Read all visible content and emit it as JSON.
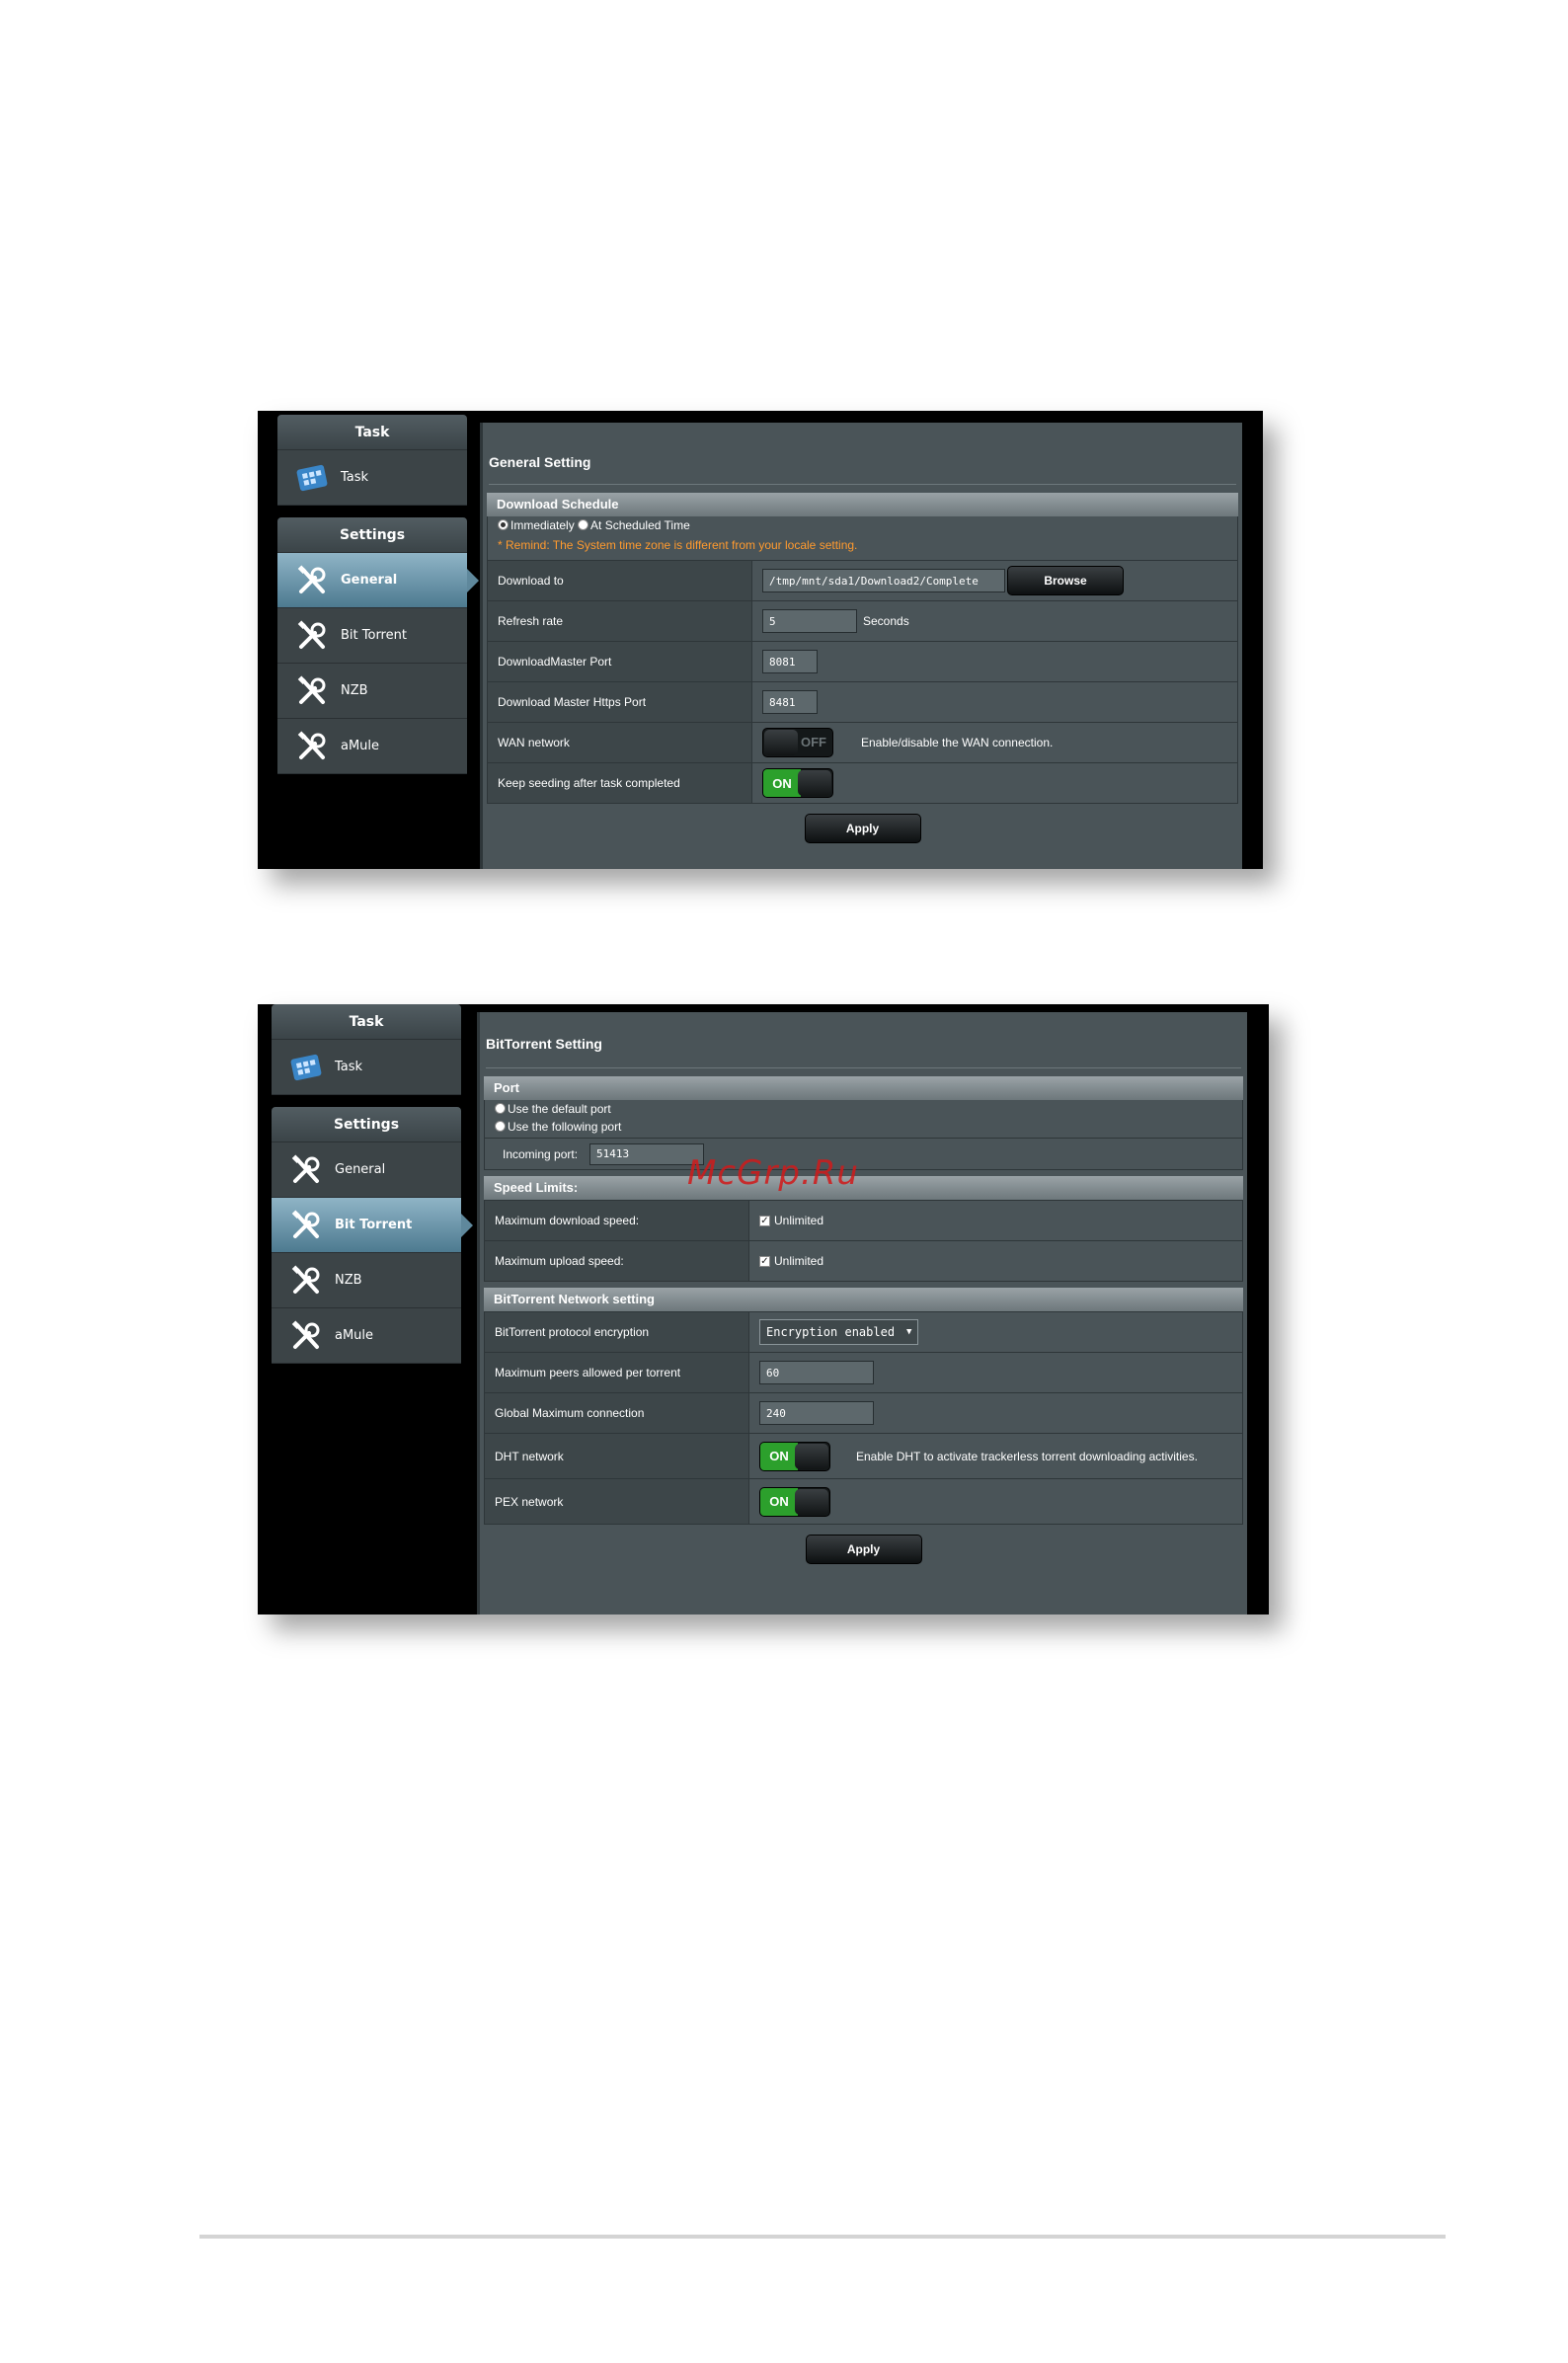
{
  "screenshot1": {
    "nav": {
      "task_header": "Task",
      "task_item": "Task",
      "settings_header": "Settings",
      "items": [
        "General",
        "Bit Torrent",
        "NZB",
        "aMule"
      ],
      "active": "General"
    },
    "title": "General Setting",
    "download_schedule": {
      "header": "Download Schedule",
      "opt_immediately": "Immediately",
      "opt_scheduled": "At Scheduled Time",
      "remind": "* Remind: The System time zone is different from your locale setting."
    },
    "rows": {
      "download_to_label": "Download to",
      "download_to_value": "/tmp/mnt/sda1/Download2/Complete",
      "browse": "Browse",
      "refresh_label": "Refresh rate",
      "refresh_value": "5",
      "refresh_unit": "Seconds",
      "dm_port_label": "DownloadMaster Port",
      "dm_port_value": "8081",
      "dm_https_label": "Download Master Https Port",
      "dm_https_value": "8481",
      "wan_label": "WAN network",
      "wan_toggle": "OFF",
      "wan_desc": "Enable/disable the WAN connection.",
      "seed_label": "Keep seeding after task completed",
      "seed_toggle": "ON"
    },
    "apply": "Apply"
  },
  "screenshot2": {
    "nav": {
      "task_header": "Task",
      "task_item": "Task",
      "settings_header": "Settings",
      "items": [
        "General",
        "Bit Torrent",
        "NZB",
        "aMule"
      ],
      "active": "Bit Torrent"
    },
    "title": "BitTorrent Setting",
    "port": {
      "header": "Port",
      "opt_default": "Use the default port",
      "opt_following": "Use the following port",
      "incoming_label": "Incoming port:",
      "incoming_value": "51413"
    },
    "speed": {
      "header": "Speed Limits:",
      "max_down_label": "Maximum download speed:",
      "max_down_value": "Unlimited",
      "max_up_label": "Maximum upload speed:",
      "max_up_value": "Unlimited"
    },
    "network": {
      "header": "BitTorrent Network setting",
      "encryption_label": "BitTorrent protocol encryption",
      "encryption_value": "Encryption enabled",
      "peers_label": "Maximum peers allowed per torrent",
      "peers_value": "60",
      "global_label": "Global Maximum connection",
      "global_value": "240",
      "dht_label": "DHT network",
      "dht_toggle": "ON",
      "dht_desc": "Enable DHT to activate trackerless torrent downloading activities.",
      "pex_label": "PEX network",
      "pex_toggle": "ON"
    },
    "apply": "Apply"
  },
  "watermark": "McGrp.Ru"
}
